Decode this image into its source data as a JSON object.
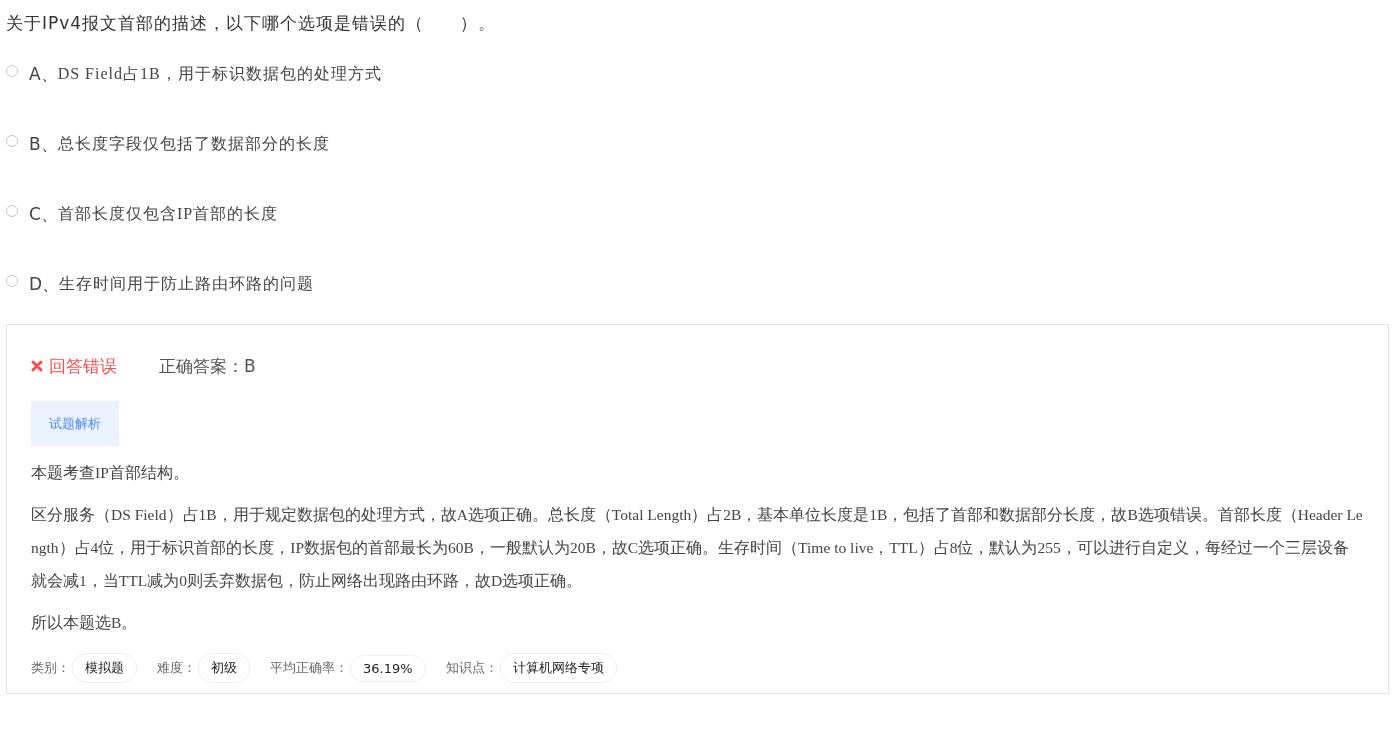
{
  "question": "关于IPv4报文首部的描述，以下哪个选项是错误的（　　）。",
  "options": [
    {
      "label": "A、",
      "text": "DS Field占1B，用于标识数据包的处理方式",
      "selected": false
    },
    {
      "label": "B、",
      "text": "总长度字段仅包括了数据部分的长度",
      "selected": false
    },
    {
      "label": "C、",
      "text": "首部长度仅包含IP首部的长度",
      "selected": false
    },
    {
      "label": "D、",
      "text": "生存时间用于防止路由环路的问题",
      "selected": false
    }
  ],
  "result": {
    "kind": "wrong",
    "text": "回答错误",
    "answer_label": "正确答案：",
    "answer": "B"
  },
  "analysis_tab": {
    "label": "试题解析",
    "selected": true
  },
  "analysis": [
    "本题考查IP首部结构。",
    "区分服务（DS Field）占1B，用于规定数据包的处理方式，故A选项正确。总长度（Total Length）占2B，基本单位长度是1B，包括了首部和数据部分长度，故B选项错误。首部长度（Header Length）占4位，用于标识首部的长度，IP数据包的首部最长为60B，一般默认为20B，故C选项正确。生存时间（Time to live，TTL）占8位，默认为255，可以进行自定义，每经过一个三层设备就会减1，当TTL减为0则丢弃数据包，防止网络出现路由环路，故D选项正确。",
    "所以本题选B。"
  ],
  "meta": [
    {
      "label": "类别：",
      "value": "模拟题"
    },
    {
      "label": "难度：",
      "value": "初级"
    },
    {
      "label": "平均正确率：",
      "value": "36.19%"
    },
    {
      "label": "知识点：",
      "value": "计算机网络专项"
    }
  ]
}
